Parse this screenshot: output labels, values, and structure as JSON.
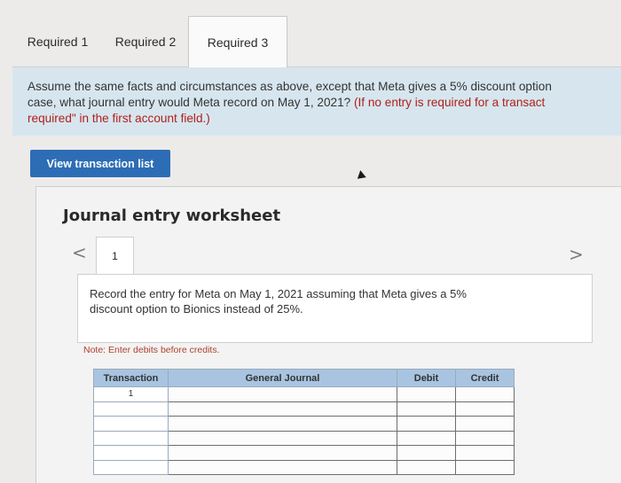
{
  "tabs": [
    {
      "label": "Required 1"
    },
    {
      "label": "Required 2"
    },
    {
      "label": "Required 3"
    }
  ],
  "question": {
    "line1": "Assume the same facts and circumstances as above, except that Meta gives a 5% discount option",
    "line2_plain": "case, what journal entry would Meta record on May 1, 2021? ",
    "line2_note": "(If no entry is required for a transact",
    "line3_note": "required\" in the first account field.)"
  },
  "view_button": {
    "label": "View transaction list"
  },
  "worksheet": {
    "title": "Journal entry worksheet",
    "page_number": "1",
    "prev_arrow": "<",
    "next_arrow": ">",
    "instruction_line1": "Record the entry for Meta on May 1, 2021 assuming that Meta gives a 5%",
    "instruction_line2": "discount option to Bionics instead of 25%.",
    "note": "Note: Enter debits before credits.",
    "table": {
      "headers": [
        "Transaction",
        "General Journal",
        "Debit",
        "Credit"
      ],
      "rows": [
        {
          "transaction": "1"
        },
        {
          "transaction": ""
        },
        {
          "transaction": ""
        },
        {
          "transaction": ""
        },
        {
          "transaction": ""
        },
        {
          "transaction": ""
        }
      ]
    }
  },
  "colors": {
    "question_bg": "#d7e6ee",
    "button_bg": "#2d6db5",
    "table_header_bg": "#a8c4e0",
    "note_color": "#b0402e",
    "emphasis_color": "#b0201e"
  }
}
